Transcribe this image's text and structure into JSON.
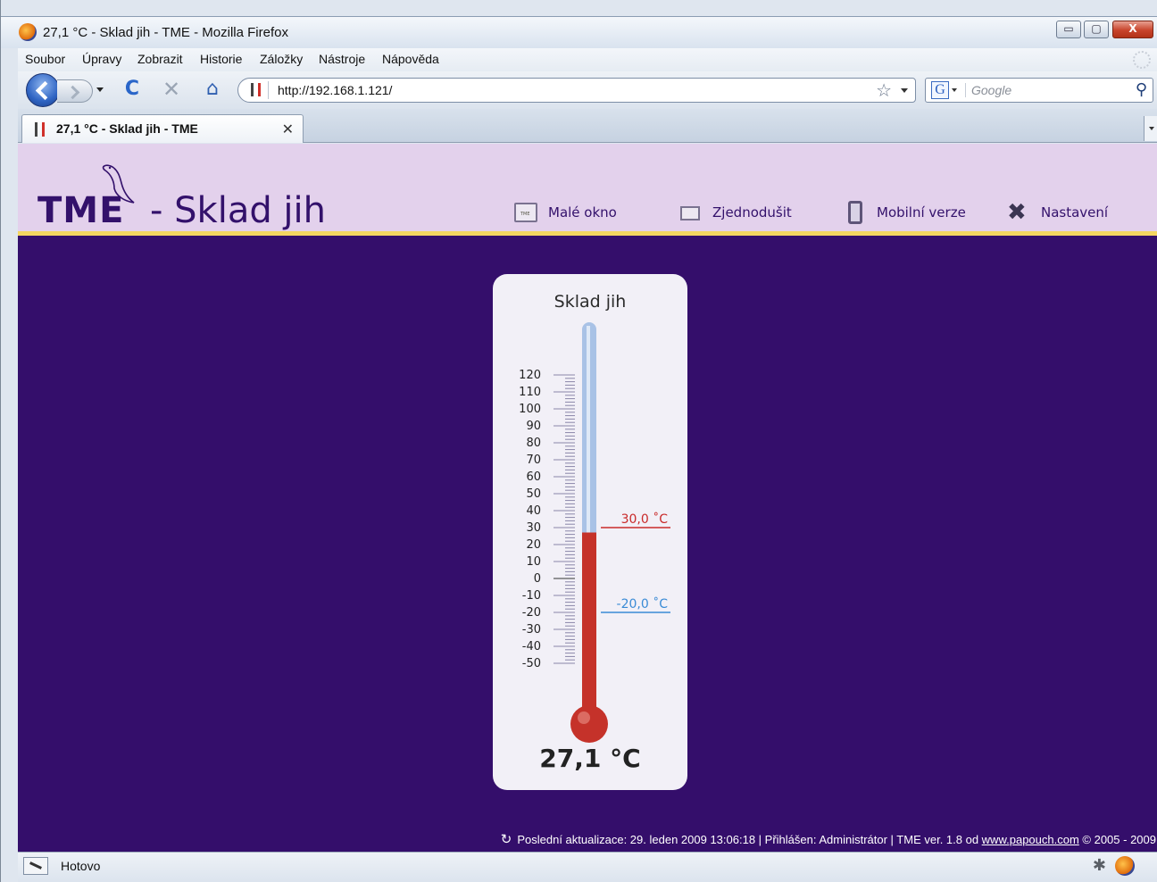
{
  "window": {
    "title": "27,1 °C - Sklad jih - TME - Mozilla Firefox",
    "minimize_glyph": "▭",
    "maximize_glyph": "▢",
    "close_glyph": "X"
  },
  "menubar": {
    "items": [
      "Soubor",
      "Úpravy",
      "Zobrazit",
      "Historie",
      "Záložky",
      "Nástroje",
      "Nápověda"
    ]
  },
  "navbar": {
    "url": "http://192.168.1.121/",
    "search_placeholder": "Google",
    "search_engine_glyph": "G",
    "icons": [
      "back-icon",
      "forward-icon",
      "reload-icon",
      "stop-icon",
      "home-icon",
      "star-icon",
      "search-icon"
    ],
    "reload_glyph": "C",
    "stop_glyph": "✕",
    "home_glyph": "⌂",
    "star_glyph": "☆",
    "search_glyph": "⚲"
  },
  "tab": {
    "label": "27,1 °C - Sklad jih - TME",
    "close_glyph": "✕"
  },
  "header": {
    "logo_text": "TME",
    "subtitle": "- Sklad jih",
    "nav": [
      {
        "label": "Malé okno",
        "icon": "window-icon"
      },
      {
        "label": "Zjednodušit",
        "icon": "simplify-icon"
      },
      {
        "label": "Mobilní verze",
        "icon": "mobile-icon"
      },
      {
        "label": "Nastavení",
        "icon": "tools-icon"
      }
    ],
    "tools_glyph": "✖"
  },
  "thermometer": {
    "title": "Sklad jih",
    "value": 27.1,
    "value_text": "27,1 °C",
    "scale_labels": [
      "120",
      "110",
      "100",
      "90",
      "80",
      "70",
      "60",
      "50",
      "40",
      "30",
      "20",
      "10",
      "0",
      "-10",
      "-20",
      "-30",
      "-40",
      "-50"
    ],
    "scale_min": -50,
    "scale_max": 120,
    "high_limit": 30,
    "high_limit_text": "30,0 ˚C",
    "low_limit": -20,
    "low_limit_text": "-20,0 ˚C",
    "colors": {
      "mercury": "#c5322a",
      "tube": "#a9c2e6",
      "high": "#c92a2a",
      "low": "#3a8bd6"
    }
  },
  "footer": {
    "refresh_glyph": "↻",
    "text_before_link": "Poslední aktualizace: 29. leden 2009 13:06:18 | Přihlášen: Administrátor | TME ver. 1.8 od ",
    "link": "www.papouch.com",
    "text_after_link": " © 2005 - 2009"
  },
  "statusbar": {
    "text": "Hotovo",
    "bug_glyph": "✱"
  },
  "colors": {
    "page_background": "#340e6b",
    "header_background": "#e3d1ec",
    "header_border": "#f4d661",
    "brand_text": "#33116b"
  }
}
